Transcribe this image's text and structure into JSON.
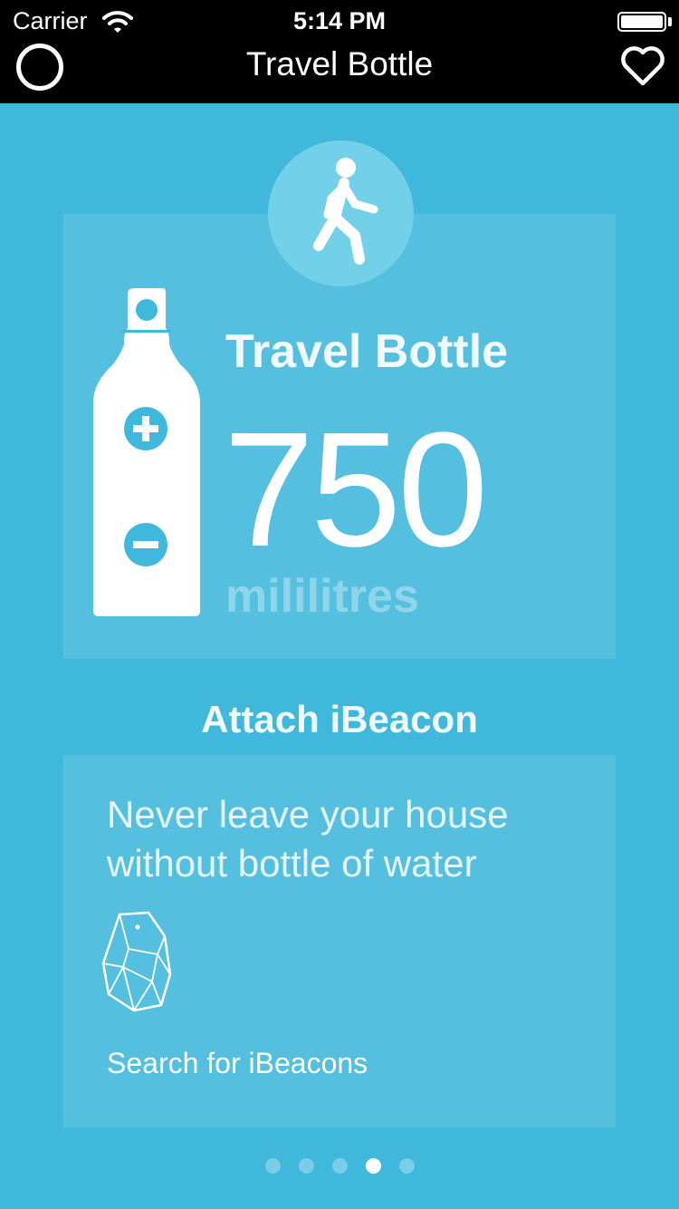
{
  "status_bar": {
    "carrier": "Carrier",
    "time": "5:14 PM"
  },
  "nav": {
    "title": "Travel Bottle",
    "left_icon": "circle-icon",
    "right_icon": "heart-icon"
  },
  "bottle": {
    "activity_icon": "walking-person-icon",
    "name": "Travel Bottle",
    "volume": "750",
    "unit": "mililitres",
    "increase_icon": "plus-icon",
    "decrease_icon": "minus-icon"
  },
  "beacon_section": {
    "title": "Attach iBeacon",
    "tagline_line1": "Never leave your house",
    "tagline_line2": "without bottle of water",
    "beacon_icon": "ibeacon-icon",
    "search_label": "Search for iBeacons"
  },
  "pagination": {
    "total": 5,
    "active_index": 3
  },
  "colors": {
    "background": "#3fb8dc",
    "badge": "#72d0e8",
    "topbar": "#000000"
  }
}
